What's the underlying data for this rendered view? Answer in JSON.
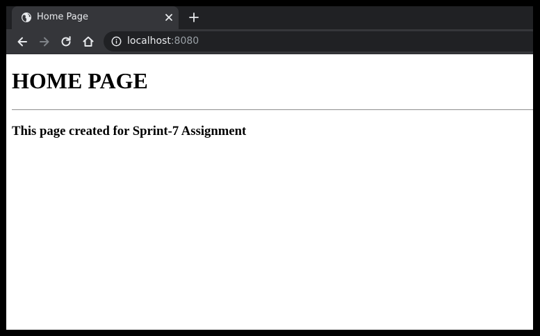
{
  "browser": {
    "tab": {
      "title": "Home Page",
      "favicon": "globe-icon",
      "close_icon": "close-icon"
    },
    "new_tab_icon": "plus-icon",
    "toolbar": {
      "back_icon": "arrow-left-icon",
      "forward_icon": "arrow-right-icon",
      "reload_icon": "reload-icon",
      "home_icon": "home-icon"
    },
    "address_bar": {
      "info_icon": "info-icon",
      "host": "localhost",
      "port": ":8080"
    },
    "colors": {
      "tabstrip": "#202124",
      "tab_active": "#35363a",
      "toolbar": "#35363a",
      "omnibox": "#202124",
      "text_light": "#e8eaed",
      "text_dim": "#9aa0a6",
      "forward_disabled": "#7f8388"
    }
  },
  "page": {
    "heading": "HOME PAGE",
    "subheading": "This page created for Sprint-7 Assignment"
  }
}
